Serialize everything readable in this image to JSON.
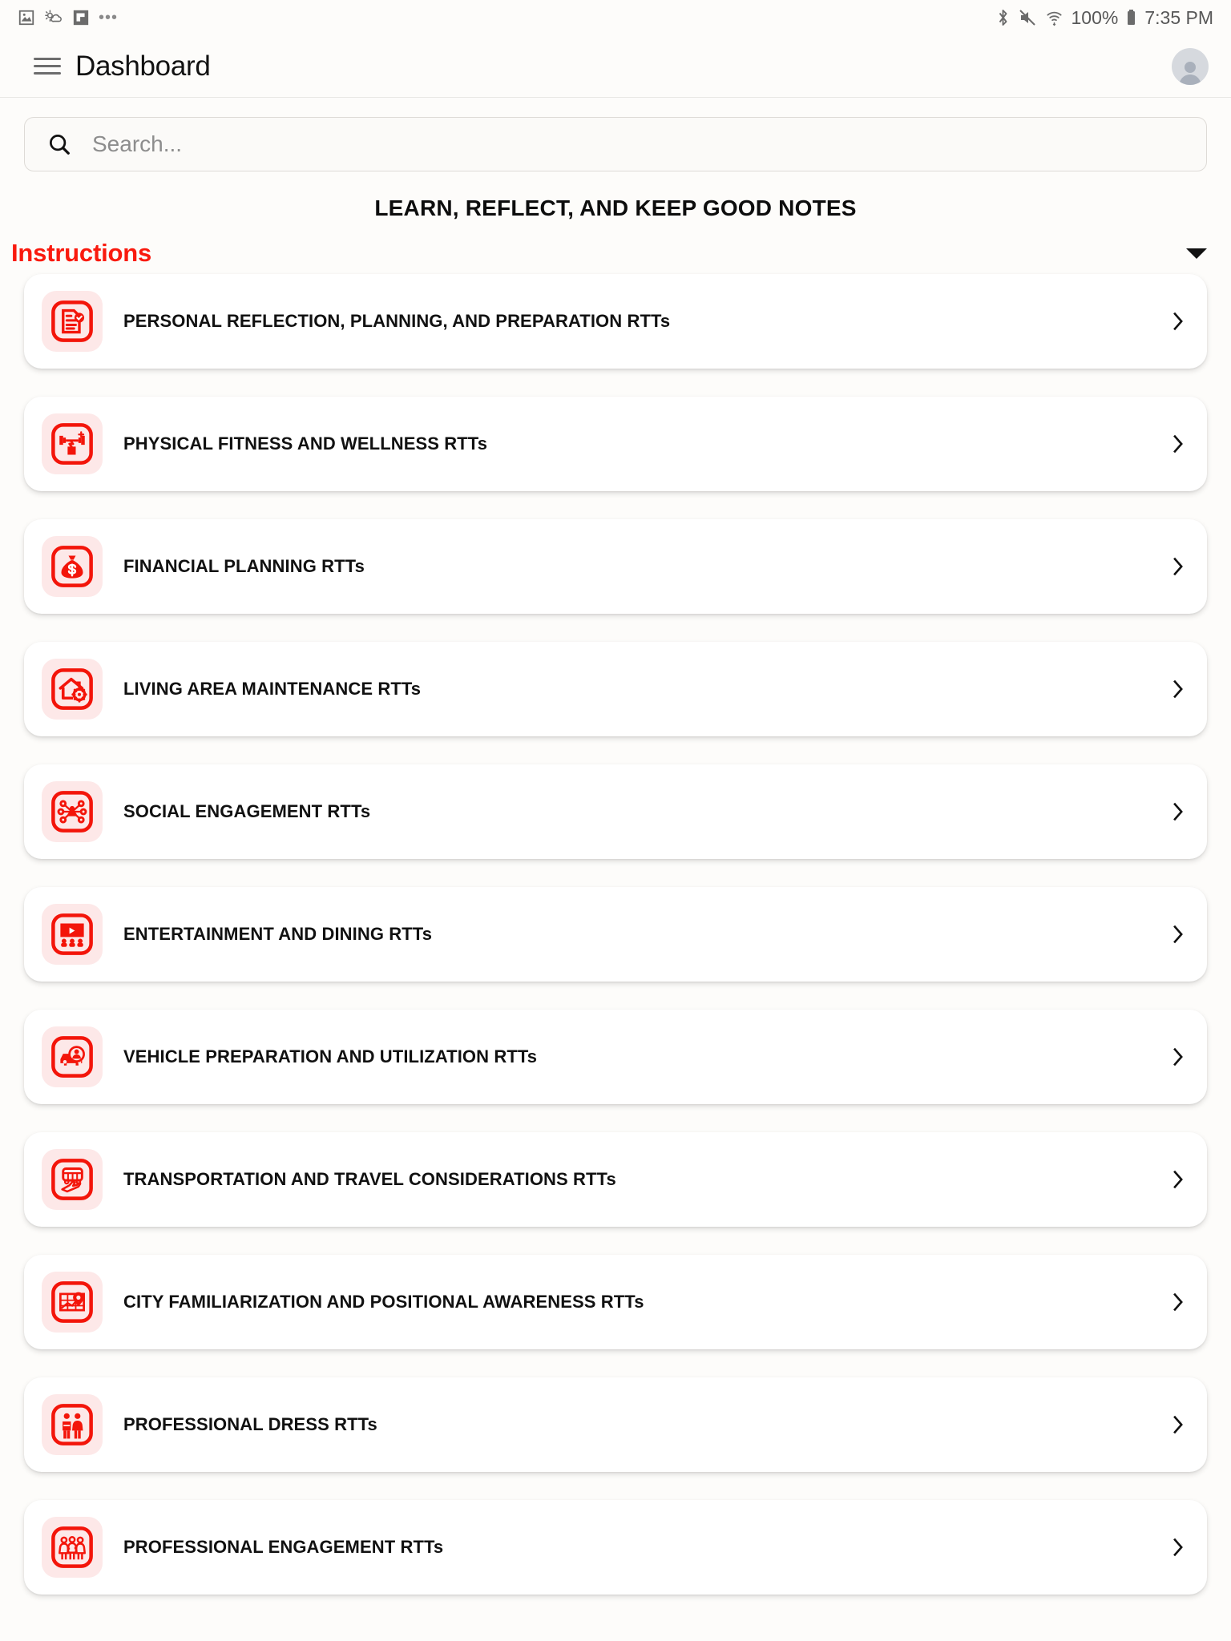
{
  "status_bar": {
    "left_icons": [
      "image-icon",
      "weather-partly-cloudy-icon",
      "flag-icon",
      "overflow-dots-icon"
    ],
    "right_icons": [
      "bluetooth-icon",
      "volume-muted-icon",
      "wifi-icon"
    ],
    "battery_percent": "100%",
    "time": "7:35 PM"
  },
  "appbar": {
    "menu_icon": "hamburger-menu-icon",
    "title": "Dashboard",
    "avatar_icon": "user-avatar-icon"
  },
  "search": {
    "icon": "search-icon",
    "placeholder": "Search...",
    "value": ""
  },
  "headline": "LEARN, REFLECT, AND KEEP GOOD NOTES",
  "section": {
    "label": "Instructions",
    "caret_icon": "chevron-down-icon",
    "expanded": true
  },
  "colors": {
    "accent": "#f91a0e",
    "icon_bg": "#fde8e8",
    "card_bg": "#ffffff",
    "page_bg": "#fdfcfa",
    "label_text": "#111111"
  },
  "list_items": [
    {
      "label": "PERSONAL REFLECTION, PLANNING, AND PREPARATION RTTs",
      "icon": "document-check-icon"
    },
    {
      "label": "PHYSICAL FITNESS AND WELLNESS RTTs",
      "icon": "dumbbell-fitness-icon"
    },
    {
      "label": "FINANCIAL PLANNING RTTs",
      "icon": "money-bag-icon"
    },
    {
      "label": "LIVING AREA MAINTENANCE RTTs",
      "icon": "house-gear-icon"
    },
    {
      "label": "SOCIAL ENGAGEMENT RTTs",
      "icon": "social-network-icon"
    },
    {
      "label": "ENTERTAINMENT AND DINING RTTs",
      "icon": "cinema-screen-icon"
    },
    {
      "label": "VEHICLE PREPARATION AND UTILIZATION RTTs",
      "icon": "car-driver-icon"
    },
    {
      "label": "TRANSPORTATION AND TRAVEL CONSIDERATIONS RTTs",
      "icon": "bus-plane-icon"
    },
    {
      "label": "CITY FAMILIARIZATION AND POSITIONAL AWARENESS RTTs",
      "icon": "map-pin-icon"
    },
    {
      "label": "PROFESSIONAL DRESS RTTs",
      "icon": "two-people-icon"
    },
    {
      "label": "PROFESSIONAL ENGAGEMENT RTTs",
      "icon": "three-people-icon"
    }
  ]
}
